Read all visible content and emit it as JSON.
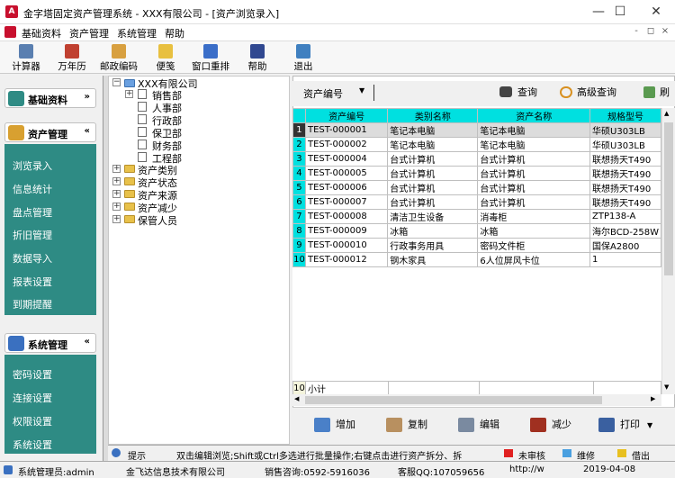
{
  "window": {
    "title": "金字塔固定资产管理系统 - XXX有限公司 - [资产浏览录入]",
    "app_icon": "A",
    "controls": {
      "minimize": "—",
      "maximize": "☐",
      "close": "✕"
    }
  },
  "menu": {
    "items": [
      "基础资料",
      "资产管理",
      "系统管理",
      "帮助"
    ],
    "mdi": {
      "minimize": "-",
      "restore": "◻",
      "close": "×"
    }
  },
  "toolbar": {
    "items": [
      {
        "label": "计算器",
        "icon": "calculator-icon",
        "color": "#5a7fb0"
      },
      {
        "label": "万年历",
        "icon": "calendar-icon",
        "color": "#c04030"
      },
      {
        "label": "邮政编码",
        "icon": "postcode-icon",
        "color": "#d8a040"
      },
      {
        "label": "便笺",
        "icon": "notepad-icon",
        "color": "#e8c040"
      },
      {
        "label": "窗口重排",
        "icon": "windows-icon",
        "color": "#3a6ec8"
      },
      {
        "label": "帮助",
        "icon": "help-book-icon",
        "color": "#304890"
      },
      {
        "label": "退出",
        "icon": "exit-icon",
        "color": "#4080c0"
      }
    ]
  },
  "sidebar": {
    "sections": [
      {
        "title": "基础资料",
        "chevron": "»",
        "items": []
      },
      {
        "title": "资产管理",
        "chevron": "«",
        "items": [
          "浏览录入",
          "信息统计",
          "盘点管理",
          "折旧管理",
          "数据导入",
          "报表设置",
          "到期提醒"
        ]
      },
      {
        "title": "系统管理",
        "chevron": "«",
        "items": [
          "密码设置",
          "连接设置",
          "权限设置",
          "系统设置"
        ]
      }
    ]
  },
  "tree": {
    "root": "XXX有限公司",
    "departments": [
      "销售部",
      "人事部",
      "行政部",
      "保卫部",
      "财务部",
      "工程部"
    ],
    "groups": [
      "资产类别",
      "资产状态",
      "资产来源",
      "资产减少",
      "保管人员"
    ]
  },
  "search": {
    "field_label": "资产编号",
    "value": "",
    "query_label": "查询",
    "advanced_label": "高级查询",
    "refresh_label": "刷"
  },
  "grid": {
    "columns": [
      "资产编号",
      "类别名称",
      "资产名称",
      "规格型号"
    ],
    "rows": [
      {
        "n": "1",
        "id": "TEST-000001",
        "category": "笔记本电脑",
        "name": "笔记本电脑",
        "spec": "华硕U303LB"
      },
      {
        "n": "2",
        "id": "TEST-000002",
        "category": "笔记本电脑",
        "name": "笔记本电脑",
        "spec": "华硕U303LB"
      },
      {
        "n": "3",
        "id": "TEST-000004",
        "category": "台式计算机",
        "name": "台式计算机",
        "spec": "联想扬天T490"
      },
      {
        "n": "4",
        "id": "TEST-000005",
        "category": "台式计算机",
        "name": "台式计算机",
        "spec": "联想扬天T490"
      },
      {
        "n": "5",
        "id": "TEST-000006",
        "category": "台式计算机",
        "name": "台式计算机",
        "spec": "联想扬天T490"
      },
      {
        "n": "6",
        "id": "TEST-000007",
        "category": "台式计算机",
        "name": "台式计算机",
        "spec": "联想扬天T490"
      },
      {
        "n": "7",
        "id": "TEST-000008",
        "category": "清洁卫生设备",
        "name": "消毒柜",
        "spec": "ZTP138-A"
      },
      {
        "n": "8",
        "id": "TEST-000009",
        "category": "冰箱",
        "name": "冰箱",
        "spec": "海尔BCD-258W"
      },
      {
        "n": "9",
        "id": "TEST-000010",
        "category": "行政事务用具",
        "name": "密码文件柜",
        "spec": "国保A2800"
      },
      {
        "n": "10",
        "id": "TEST-000012",
        "category": "钢木家具",
        "name": "6人位屏风卡位",
        "spec": "1"
      }
    ],
    "footer": {
      "n": "10",
      "label": "小计"
    }
  },
  "actions": [
    "增加",
    "复制",
    "编辑",
    "减少",
    "打印"
  ],
  "hint": {
    "label": "提示",
    "text": "双击编辑浏览;Shift或Ctrl多选进行批量操作;右键点击进行资产拆分、拆",
    "legend": [
      {
        "label": "未审核",
        "color": "#e02020"
      },
      {
        "label": "维修",
        "color": "#4aa0e0"
      },
      {
        "label": "借出",
        "color": "#e8c020"
      }
    ]
  },
  "status": {
    "admin": "系统管理员:admin",
    "company": "金飞达信息技术有限公司",
    "phone": "销售咨询:0592-5916036",
    "qq": "客服QQ:107059656",
    "url": "http://w",
    "date": "2019-04-08"
  },
  "colors": {
    "sidebar_bg": "#2e8b84",
    "grid_header": "#00e0e0",
    "selected_row": "#dcdcdc"
  }
}
